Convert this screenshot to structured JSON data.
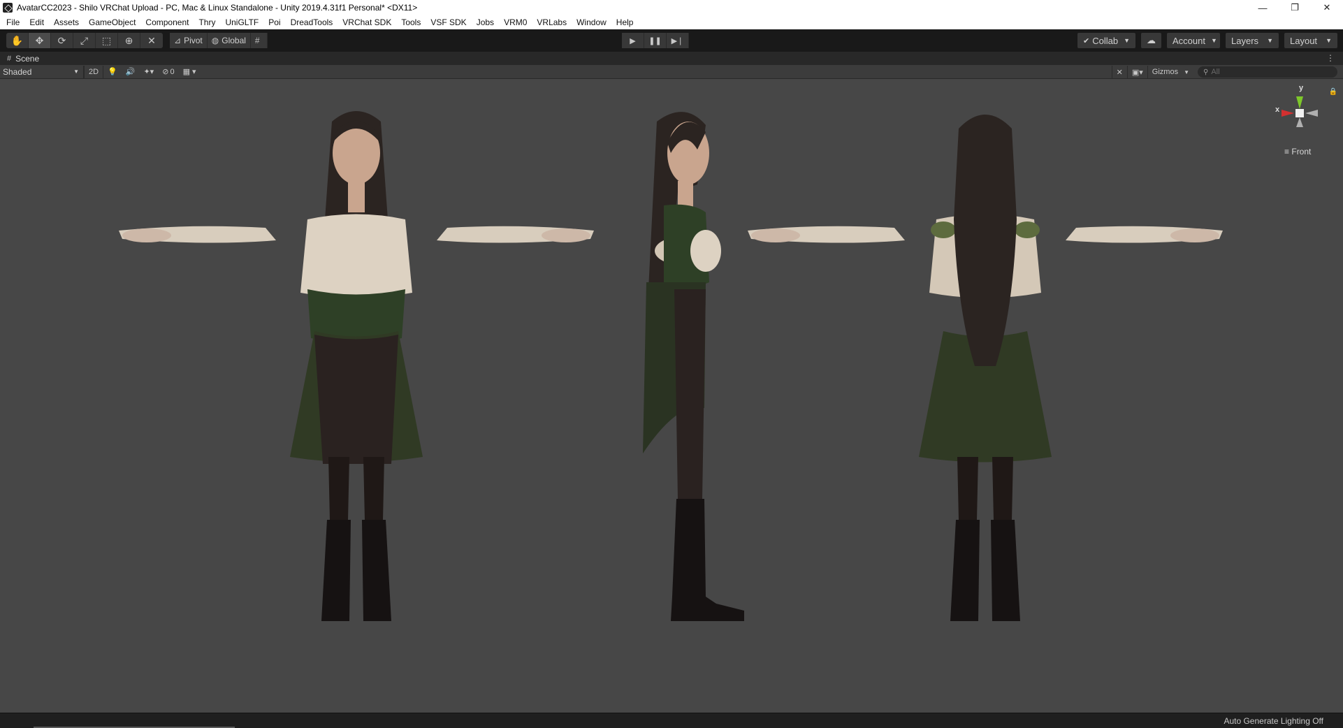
{
  "window": {
    "title": "AvatarCC2023 - Shilo VRChat Upload - PC, Mac & Linux Standalone - Unity 2019.4.31f1 Personal* <DX11>",
    "controls": {
      "minimize": "—",
      "restore": "❐",
      "close": "✕"
    }
  },
  "menu": [
    "File",
    "Edit",
    "Assets",
    "GameObject",
    "Component",
    "Thry",
    "UniGLTF",
    "Poi",
    "DreadTools",
    "VRChat SDK",
    "Tools",
    "VSF SDK",
    "Jobs",
    "VRM0",
    "VRLabs",
    "Window",
    "Help"
  ],
  "toolbar": {
    "tools": [
      {
        "name": "hand-tool",
        "glyph": "✋"
      },
      {
        "name": "move-tool",
        "glyph": "✥",
        "active": true
      },
      {
        "name": "rotate-tool",
        "glyph": "⟳"
      },
      {
        "name": "scale-tool",
        "glyph": "⤢"
      },
      {
        "name": "rect-tool",
        "glyph": "⬚"
      },
      {
        "name": "transform-tool",
        "glyph": "⊕"
      },
      {
        "name": "custom-tool",
        "glyph": "✕"
      }
    ],
    "pivot_label": "Pivot",
    "global_label": "Global",
    "collab_label": "Collab",
    "account_label": "Account",
    "layers_label": "Layers",
    "layout_label": "Layout"
  },
  "scene": {
    "tab_label": "Scene",
    "shading_mode": "Shaded",
    "two_d_label": "2D",
    "hidden_count": "0",
    "gizmos_label": "Gizmos",
    "search_placeholder": "All",
    "view_label": "Front",
    "axis_y": "y",
    "axis_x": "x"
  },
  "status": {
    "text": "Auto Generate Lighting Off"
  },
  "colors": {
    "viewport_bg": "#474747",
    "toolbar_bg": "#191919",
    "axis_y": "#7ec82a",
    "axis_x": "#d43030",
    "axis_z": "#b0b0b0"
  }
}
